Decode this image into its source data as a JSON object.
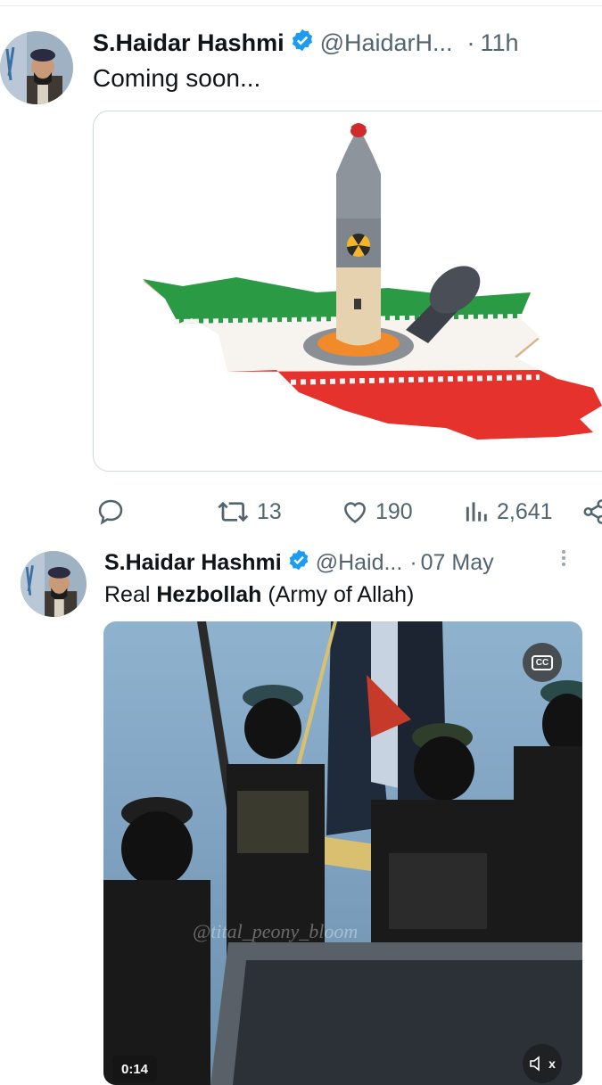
{
  "tweet1": {
    "author_name": "S.Haidar Hashmi",
    "handle": "@HaidarH...",
    "separator": "·",
    "time": "11h",
    "text": "Coming soon...",
    "media_icon": "missile-on-iran-map-image",
    "actions": {
      "reply_icon": "reply-icon",
      "retweet_count": "13",
      "like_count": "190",
      "views_count": "2,641"
    }
  },
  "tweet2": {
    "author_name": "S.Haidar Hashmi",
    "handle": "@Haid...",
    "separator": "·",
    "time": "07 May",
    "text_prefix": "Real ",
    "text_bold": "Hezbollah",
    "text_suffix": " (Army of Allah)",
    "media_icon": "armed-militants-video",
    "cc_label": "CC",
    "watermark": "@tital_peony_bloom",
    "timer": "0:14",
    "mute_label": "x"
  },
  "colors": {
    "verified_blue": "#1d9bf0",
    "secondary_text": "#536471",
    "border": "#cfd9de"
  }
}
